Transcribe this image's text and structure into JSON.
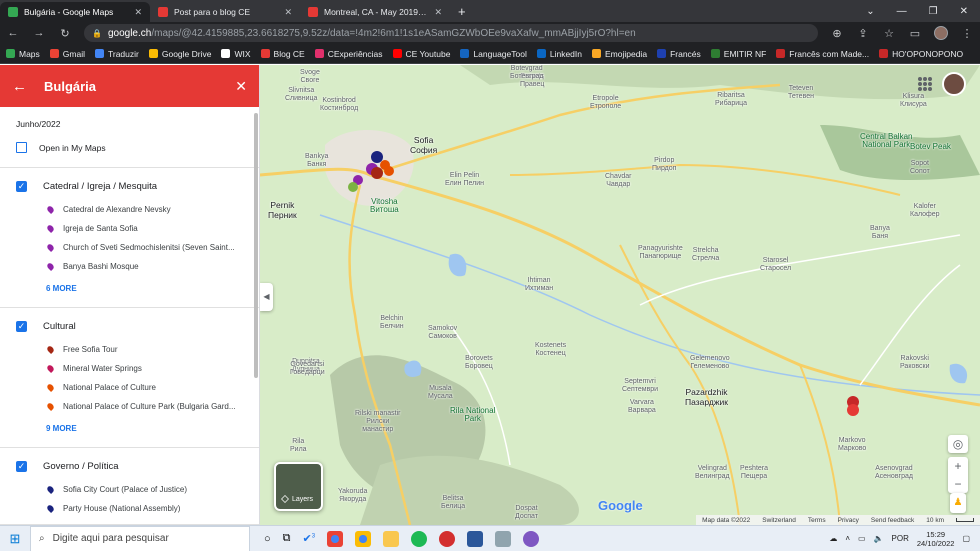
{
  "browser": {
    "tabs": [
      {
        "title": "Bulgária - Google Maps",
        "color": "#34a853",
        "active": true
      },
      {
        "title": "Post para o blog CE",
        "color": "#e53935",
        "active": false
      },
      {
        "title": "Montreal, CA - May 2019 - Goog",
        "color": "#e53935",
        "active": false
      }
    ],
    "new_tab": "+",
    "url_host": "google.ch",
    "url_path": "/maps/@42.4159885,23.6618275,9.52z/data=!4m2!6m1!1s1eASamGZWbOEe9vaXafw_mmABjjIyj5rO?hl=en",
    "bookmarks": [
      {
        "label": "Maps",
        "color": "#34a853"
      },
      {
        "label": "Gmail",
        "color": "#ea4335"
      },
      {
        "label": "Traduzir",
        "color": "#4285f4"
      },
      {
        "label": "Google Drive",
        "color": "#fbbc04"
      },
      {
        "label": "WIX",
        "color": "#ffffff"
      },
      {
        "label": "Blog CE",
        "color": "#e53935"
      },
      {
        "label": "CExperiências",
        "color": "#e1306c"
      },
      {
        "label": "CE Youtube",
        "color": "#ff0000"
      },
      {
        "label": "LanguageTool",
        "color": "#1565c0"
      },
      {
        "label": "LinkedIn",
        "color": "#0a66c2"
      },
      {
        "label": "Emojipedia",
        "color": "#f9a825"
      },
      {
        "label": "Francés",
        "color": "#1e40af"
      },
      {
        "label": "EMITIR NF",
        "color": "#2e7d32"
      },
      {
        "label": "Francês com Made...",
        "color": "#c62828"
      },
      {
        "label": "HO'OPONOPONO",
        "color": "#c62828"
      }
    ]
  },
  "panel": {
    "title": "Bulgária",
    "date": "Junho/2022",
    "open_my_maps": "Open in My Maps",
    "layers": [
      {
        "name": "Catedral / Igreja / Mesquita",
        "items": [
          {
            "label": "Catedral de Alexandre Nevsky",
            "color": "#8e24aa"
          },
          {
            "label": "Igreja de Santa Sofia",
            "color": "#8e24aa"
          },
          {
            "label": "Church of Sveti Sedmochislenitsi (Seven Saint...",
            "color": "#8e24aa"
          },
          {
            "label": "Banya Bashi Mosque",
            "color": "#8e24aa"
          }
        ],
        "more": "6 MORE"
      },
      {
        "name": "Cultural",
        "items": [
          {
            "label": "Free Sofia Tour",
            "color": "#a52714"
          },
          {
            "label": "Mineral Water Springs",
            "color": "#c2185b"
          },
          {
            "label": "National Palace of Culture",
            "color": "#e65100"
          },
          {
            "label": "National Palace of Culture Park (Bulgaria Gard...",
            "color": "#e65100"
          }
        ],
        "more": "9 MORE"
      },
      {
        "name": "Governo / Política",
        "items": [
          {
            "label": "Sofia City Court (Palace of Justice)",
            "color": "#1a237e"
          },
          {
            "label": "Party House (National Assembly)",
            "color": "#1a237e"
          }
        ],
        "more": ""
      }
    ]
  },
  "map": {
    "labels": [
      {
        "t": "Svoge\nСвoге",
        "k": ""
      },
      {
        "t": "Slivnitsa\nСливница",
        "k": ""
      },
      {
        "t": "Kostinbrod\nКостинброд",
        "k": ""
      },
      {
        "t": "Bankya\nБанкя",
        "k": ""
      },
      {
        "t": "Sofia\nСофия",
        "k": "big"
      },
      {
        "t": "Pernik\nПерник",
        "k": "big"
      },
      {
        "t": "Vitosha\nВитоша",
        "k": "park"
      },
      {
        "t": "Elin Pelin\nЕлин Пелин",
        "k": ""
      },
      {
        "t": "Etropole\nЕтрополе",
        "k": ""
      },
      {
        "t": "Pravets\nПравец",
        "k": ""
      },
      {
        "t": "Botevgrad\nБотевград",
        "k": ""
      },
      {
        "t": "Chavdar\nЧавдар",
        "k": ""
      },
      {
        "t": "Pirdop\nПирдоп",
        "k": ""
      },
      {
        "t": "Ribaritsa\nРибарица",
        "k": ""
      },
      {
        "t": "Teteven\nТетевен",
        "k": ""
      },
      {
        "t": "Klisura\nКлисура",
        "k": ""
      },
      {
        "t": "Sopot\nСопот",
        "k": ""
      },
      {
        "t": "Central Balkan\nNational Park",
        "k": "park"
      },
      {
        "t": "Botev Peak",
        "k": "park"
      },
      {
        "t": "Kalofer\nКалофер",
        "k": ""
      },
      {
        "t": "Banya\nБаня",
        "k": ""
      },
      {
        "t": "Panagyurishte\nПанагюрище",
        "k": ""
      },
      {
        "t": "Strelcha\nСтрелча",
        "k": ""
      },
      {
        "t": "Starosel\nСтаросел",
        "k": ""
      },
      {
        "t": "Ihtiman\nИхтиман",
        "k": ""
      },
      {
        "t": "Belchin\nБелчин",
        "k": ""
      },
      {
        "t": "Samokov\nСамоков",
        "k": ""
      },
      {
        "t": "Kostenets\nКостенец",
        "k": ""
      },
      {
        "t": "Dupnitsa\nДупница",
        "k": ""
      },
      {
        "t": "Govedartsi\nГовeдарци",
        "k": ""
      },
      {
        "t": "Borovets\nБоровец",
        "k": ""
      },
      {
        "t": "Musala\nМусала",
        "k": ""
      },
      {
        "t": "Rila National\nPark",
        "k": "park"
      },
      {
        "t": "Rilski manastir\nРилски\nманастир",
        "k": ""
      },
      {
        "t": "Rila\nРила",
        "k": ""
      },
      {
        "t": "Septemvri\nСептември",
        "k": ""
      },
      {
        "t": "Varvara\nВарвара",
        "k": ""
      },
      {
        "t": "Pazardzhik\nПазарджик",
        "k": "big"
      },
      {
        "t": "Velingrad\nВелинград",
        "k": ""
      },
      {
        "t": "Peshtera\nПещера",
        "k": ""
      },
      {
        "t": "Belitsa\nБелица",
        "k": ""
      },
      {
        "t": "Gelemenovo\nГелеменово",
        "k": ""
      },
      {
        "t": "Rakovski\nРаковски",
        "k": ""
      },
      {
        "t": "Markovo\nМарково",
        "k": ""
      },
      {
        "t": "Asenovgrad\nАсеновград",
        "k": ""
      },
      {
        "t": "Yakoruda\nЯкоруда",
        "k": ""
      },
      {
        "t": "Dospat\nДоспат",
        "k": ""
      }
    ],
    "layers_label": "Layers",
    "google_logo": "Google",
    "footer": [
      "Map data ©2022",
      "Switzerland",
      "Terms",
      "Privacy",
      "Send feedback",
      "10 km"
    ],
    "zoom_in": "+",
    "zoom_out": "−"
  },
  "taskbar": {
    "search_placeholder": "Digite aqui para pesquisar",
    "badge": "3",
    "lang": "POR",
    "time": "15:29",
    "date": "24/10/2022"
  },
  "colors": {
    "header_red": "#e53935",
    "accent_blue": "#1a73e8",
    "map_bg": "#d8ecc8",
    "road_yellow": "#f6cf65"
  }
}
